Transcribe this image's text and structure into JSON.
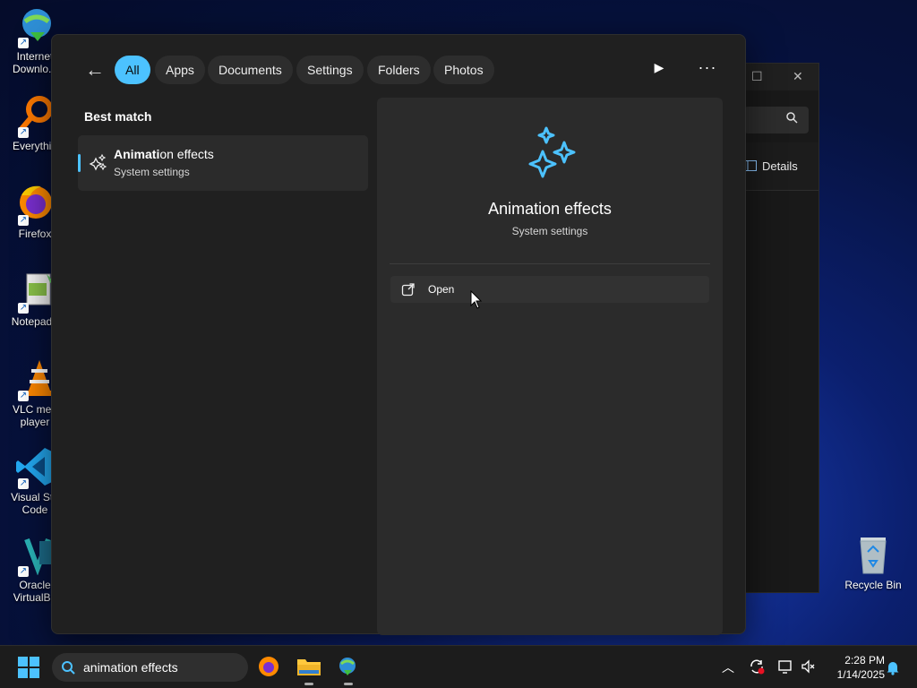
{
  "desktop": {
    "icons": [
      {
        "label": "Internet Downlo...",
        "icon": "internet-download-manager-icon"
      },
      {
        "label": "Everythin",
        "icon": "everything-search-icon"
      },
      {
        "label": "Firefox",
        "icon": "firefox-icon"
      },
      {
        "label": "Notepad+",
        "icon": "notepad-plus-plus-icon"
      },
      {
        "label": "VLC med player",
        "icon": "vlc-icon"
      },
      {
        "label": "Visual Stu Code",
        "icon": "vscode-icon"
      },
      {
        "label": "Oracle VirtualBo",
        "icon": "virtualbox-icon"
      }
    ],
    "recycle_bin": "Recycle Bin"
  },
  "background_window": {
    "details_label": "Details"
  },
  "search_panel": {
    "filters": [
      "All",
      "Apps",
      "Documents",
      "Settings",
      "Folders",
      "Photos"
    ],
    "active_filter": "All",
    "best_match_heading": "Best match",
    "result": {
      "title_bold": "Animati",
      "title_rest": "on effects",
      "subtitle": "System settings"
    },
    "detail": {
      "title": "Animation effects",
      "subtitle": "System settings",
      "action_open": "Open"
    }
  },
  "taskbar": {
    "search_text": "animation effects",
    "time": "2:28 PM",
    "date": "1/14/2025"
  },
  "colors": {
    "accent": "#4cc2ff",
    "panel_bg": "#202020",
    "card_bg": "#2b2b2b"
  }
}
